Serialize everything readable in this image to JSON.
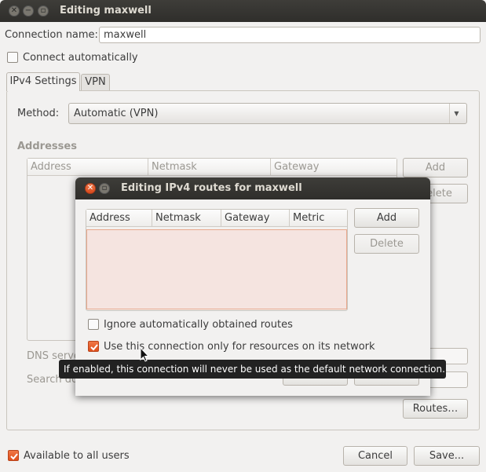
{
  "main_window": {
    "title": "Editing maxwell",
    "connection_name_label": "Connection name:",
    "connection_name_value": "maxwell",
    "connect_automatically_label": "Connect automatically",
    "tabs": [
      {
        "label": "IPv4 Settings"
      },
      {
        "label": "VPN"
      }
    ],
    "method_label": "Method:",
    "method_value": "Automatic (VPN)",
    "addresses_heading": "Addresses",
    "addresses_columns": [
      "Address",
      "Netmask",
      "Gateway"
    ],
    "add_label": "Add",
    "delete_label": "Delete",
    "dns_servers_label": "DNS servers:",
    "search_domains_label": "Search domains:",
    "routes_label": "Routes…",
    "available_to_all_users_label": "Available to all users",
    "cancel_label": "Cancel",
    "save_label": "Save..."
  },
  "routes_dialog": {
    "title": "Editing IPv4 routes for maxwell",
    "columns": [
      "Address",
      "Netmask",
      "Gateway",
      "Metric"
    ],
    "add_label": "Add",
    "delete_label": "Delete",
    "ignore_routes_label": "Ignore automatically obtained routes",
    "ignore_routes_checked": false,
    "only_resources_label": "Use this connection only for resources on its network",
    "only_resources_checked": true,
    "cancel_label": "Cancel",
    "ok_label": "OK"
  },
  "tooltip": {
    "text": "If enabled, this connection will never be used as the default network connection."
  },
  "colors": {
    "titlebar": "#3c3b37",
    "accent_checkbox": "#e6572a",
    "table_error_bg": "#f5e4e0",
    "table_error_border": "#e8a88c",
    "tooltip_bg": "#222222"
  }
}
